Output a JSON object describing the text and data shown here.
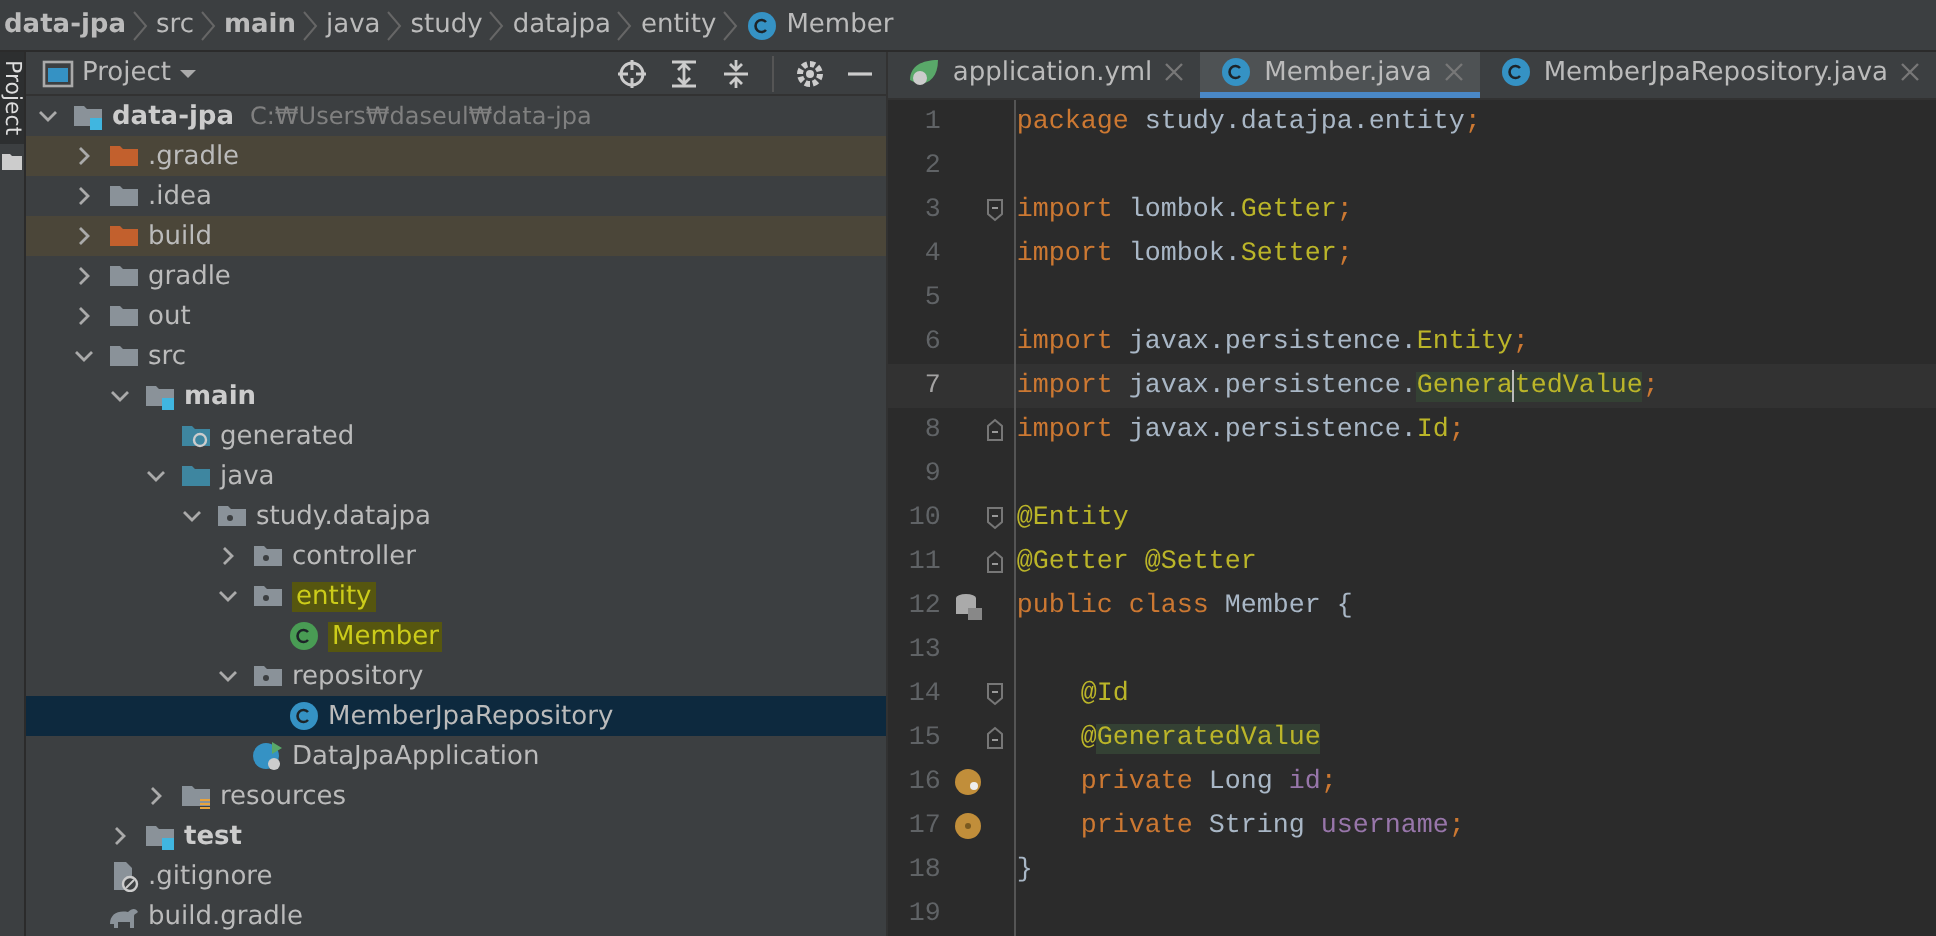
{
  "breadcrumb": [
    {
      "text": "data-jpa",
      "bold": true
    },
    {
      "text": "src",
      "bold": false
    },
    {
      "text": "main",
      "bold": true
    },
    {
      "text": "java",
      "bold": false
    },
    {
      "text": "study",
      "bold": false
    },
    {
      "text": "datajpa",
      "bold": false
    },
    {
      "text": "entity",
      "bold": false
    },
    {
      "text": "Member",
      "bold": false,
      "kind": "class"
    }
  ],
  "tool_strip": {
    "label": "Project"
  },
  "project_panel": {
    "title": "Project",
    "tree": [
      {
        "name": "data-jpa",
        "path": "C:₩Users₩daseul₩data-jpa",
        "kind": "module",
        "expanded": true,
        "selected": false,
        "children": [
          {
            "name": ".gradle",
            "kind": "excluded",
            "expanded": false,
            "selected": false
          },
          {
            "name": ".idea",
            "kind": "folder",
            "expanded": false,
            "selected": false
          },
          {
            "name": "build",
            "kind": "excluded",
            "expanded": false,
            "selected": false
          },
          {
            "name": "gradle",
            "kind": "folder",
            "expanded": false,
            "selected": false
          },
          {
            "name": "out",
            "kind": "folder",
            "expanded": false,
            "selected": false
          },
          {
            "name": "src",
            "kind": "folder",
            "expanded": true,
            "selected": false,
            "children": [
              {
                "name": "main",
                "kind": "module",
                "expanded": true,
                "selected": false,
                "children": [
                  {
                    "name": "generated",
                    "kind": "generated",
                    "selected": false
                  },
                  {
                    "name": "java",
                    "kind": "source",
                    "expanded": true,
                    "selected": false,
                    "children": [
                      {
                        "name": "study.datajpa",
                        "kind": "package",
                        "expanded": true,
                        "selected": false,
                        "children": [
                          {
                            "name": "controller",
                            "kind": "package",
                            "expanded": false,
                            "selected": false
                          },
                          {
                            "name": "entity",
                            "kind": "package",
                            "expanded": true,
                            "selected": false,
                            "highlighted": true,
                            "children": [
                              {
                                "name": "Member",
                                "kind": "class",
                                "color": "#499c54",
                                "selected": false,
                                "highlighted": true
                              }
                            ]
                          },
                          {
                            "name": "repository",
                            "kind": "package",
                            "expanded": true,
                            "selected": false,
                            "children": [
                              {
                                "name": "MemberJpaRepository",
                                "kind": "class",
                                "color": "#3592c4",
                                "selected": true
                              }
                            ]
                          },
                          {
                            "name": "DataJpaApplication",
                            "kind": "app",
                            "selected": false
                          }
                        ]
                      }
                    ]
                  },
                  {
                    "name": "resources",
                    "kind": "resources",
                    "expanded": false,
                    "selected": false
                  }
                ]
              },
              {
                "name": "test",
                "kind": "module",
                "expanded": false,
                "selected": false
              }
            ]
          },
          {
            "name": ".gitignore",
            "kind": "ignore",
            "selected": false
          },
          {
            "name": "build.gradle",
            "kind": "gradle",
            "selected": false
          }
        ]
      }
    ]
  },
  "editor": {
    "tabs": [
      {
        "label": "application.yml",
        "kind": "spring",
        "selected": false
      },
      {
        "label": "Member.java",
        "kind": "class",
        "selected": true
      },
      {
        "label": "MemberJpaRepository.java",
        "kind": "class",
        "selected": false
      }
    ],
    "lines": [
      {
        "number": "1",
        "tokens": [
          {
            "text": "package ",
            "kind": "keyword"
          },
          {
            "text": "study.datajpa.entity",
            "kind": "plain"
          },
          {
            "text": ";",
            "kind": "keyword"
          }
        ]
      },
      {
        "number": "2"
      },
      {
        "number": "3",
        "fold": {
          "kind": "start"
        },
        "tokens": [
          {
            "text": "import ",
            "kind": "keyword"
          },
          {
            "text": "lombok.",
            "kind": "plain"
          },
          {
            "text": "Getter",
            "kind": "annotation"
          },
          {
            "text": ";",
            "kind": "keyword"
          }
        ]
      },
      {
        "number": "4",
        "tokens": [
          {
            "text": "import ",
            "kind": "keyword"
          },
          {
            "text": "lombok.",
            "kind": "plain"
          },
          {
            "text": "Setter",
            "kind": "annotation"
          },
          {
            "text": ";",
            "kind": "keyword"
          }
        ]
      },
      {
        "number": "5"
      },
      {
        "number": "6",
        "tokens": [
          {
            "text": "import ",
            "kind": "keyword"
          },
          {
            "text": "javax.persistence.",
            "kind": "plain"
          },
          {
            "text": "Entity",
            "kind": "annotation"
          },
          {
            "text": ";",
            "kind": "keyword"
          }
        ]
      },
      {
        "number": "7",
        "current": true,
        "tokens": [
          {
            "text": "import ",
            "kind": "keyword"
          },
          {
            "text": "javax.persistence.",
            "kind": "plain"
          },
          {
            "text": "Genera",
            "kind": "annotation",
            "highlighted": true
          },
          {
            "text": "tedValue",
            "kind": "annotation",
            "highlighted": true,
            "caret_before": true
          },
          {
            "text": ";",
            "kind": "keyword"
          }
        ]
      },
      {
        "number": "8",
        "fold": {
          "kind": "end"
        },
        "tokens": [
          {
            "text": "import ",
            "kind": "keyword"
          },
          {
            "text": "javax.persistence.",
            "kind": "plain"
          },
          {
            "text": "Id",
            "kind": "annotation"
          },
          {
            "text": ";",
            "kind": "keyword"
          }
        ]
      },
      {
        "number": "9"
      },
      {
        "number": "10",
        "fold": {
          "kind": "start"
        },
        "tokens": [
          {
            "text": "@Entity",
            "kind": "annotation"
          }
        ]
      },
      {
        "number": "11",
        "fold": {
          "kind": "end"
        },
        "tokens": [
          {
            "text": "@Getter @Setter",
            "kind": "annotation"
          }
        ]
      },
      {
        "number": "12",
        "gutter": {
          "kind": "database"
        },
        "tokens": [
          {
            "text": "public class ",
            "kind": "keyword"
          },
          {
            "text": "Member {",
            "kind": "plain"
          }
        ]
      },
      {
        "number": "13"
      },
      {
        "number": "14",
        "fold": {
          "kind": "start"
        },
        "tokens": [
          {
            "text": "    @Id",
            "kind": "annotation"
          }
        ]
      },
      {
        "number": "15",
        "fold": {
          "kind": "end"
        },
        "tokens": [
          {
            "text": "    @",
            "kind": "annotation"
          },
          {
            "text": "GeneratedValue",
            "kind": "annotation",
            "highlighted": true
          }
        ]
      },
      {
        "number": "16",
        "gutter": {
          "kind": "key-field"
        },
        "tokens": [
          {
            "text": "    private ",
            "kind": "keyword"
          },
          {
            "text": "Long ",
            "kind": "plain"
          },
          {
            "text": "id",
            "kind": "field"
          },
          {
            "text": ";",
            "kind": "keyword"
          }
        ]
      },
      {
        "number": "17",
        "gutter": {
          "kind": "field"
        },
        "tokens": [
          {
            "text": "    private ",
            "kind": "keyword"
          },
          {
            "text": "String ",
            "kind": "plain"
          },
          {
            "text": "username",
            "kind": "field"
          },
          {
            "text": ";",
            "kind": "keyword"
          }
        ]
      },
      {
        "number": "18",
        "tokens": [
          {
            "text": "}",
            "kind": "plain"
          }
        ]
      },
      {
        "number": "19"
      }
    ]
  }
}
